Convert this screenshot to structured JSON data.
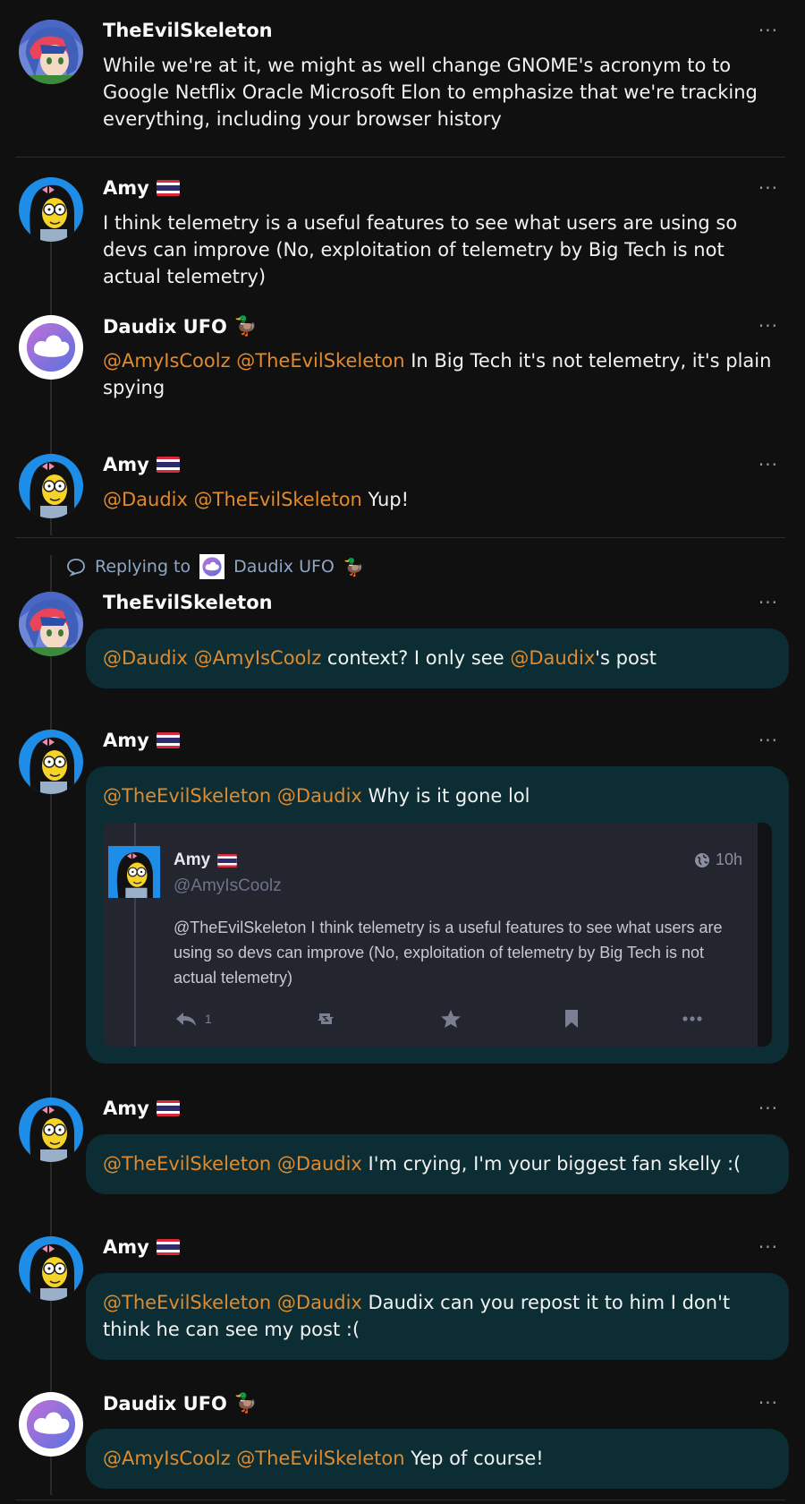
{
  "colors": {
    "background": "#101010",
    "mention": "#e08a2d",
    "bubble": "#0b2d33",
    "reply_context": "#8ea7c4"
  },
  "posts": [
    {
      "author": "TheEvilSkeleton",
      "text": "While we're at it, we might as well change GNOME's acronym to to Google Netflix Oracle Microsoft Elon to emphasize that we're tracking everything, including your browser history"
    },
    {
      "author": "Amy",
      "text": "I think telemetry is a useful features to see what users are using so devs can improve (No, exploitation of telemetry by Big Tech is not actual telemetry)"
    },
    {
      "author": "Daudix UFO",
      "emoji": "🦆",
      "mention1": "@AmyIsCoolz",
      "mention2": "@TheEvilSkeleton",
      "text": " In Big Tech it's not telemetry, it's plain spying"
    },
    {
      "author": "Amy",
      "mention1": "@Daudix",
      "mention2": "@TheEvilSkeleton",
      "text": " Yup!"
    },
    {
      "author": "TheEvilSkeleton",
      "mention1": "@Daudix",
      "mention2": "@AmyIsCoolz",
      "text1": " context? I only see ",
      "mention3": "@Daudix",
      "text2": "'s post"
    },
    {
      "author": "Amy",
      "mention1": "@TheEvilSkeleton",
      "mention2": "@Daudix",
      "text": " Why is it gone lol"
    },
    {
      "author": "Amy",
      "mention1": "@TheEvilSkeleton",
      "mention2": "@Daudix",
      "text": " I'm crying, I'm your biggest fan skelly :("
    },
    {
      "author": "Amy",
      "mention1": "@TheEvilSkeleton",
      "mention2": "@Daudix",
      "text": " Daudix can you repost it to him I don't think he can see my post :("
    },
    {
      "author": "Daudix UFO",
      "emoji": "🦆",
      "mention1": "@AmyIsCoolz",
      "mention2": "@TheEvilSkeleton",
      "text": " Yep of course!"
    }
  ],
  "reply_context": {
    "label": "Replying to",
    "target": "Daudix UFO",
    "emoji": "🦆"
  },
  "more_label": "···",
  "embedded": {
    "author": "Amy",
    "handle": "@AmyIsCoolz",
    "time": "10h",
    "mention": "@TheEvilSkeleton",
    "text": " I think telemetry is a useful features to see what users are using so devs can improve (No, exploitation of telemetry by Big Tech is not actual telemetry)",
    "reply_count": "1",
    "icons": [
      "reply-icon",
      "boost-icon",
      "star-icon",
      "bookmark-icon",
      "more-icon"
    ]
  }
}
